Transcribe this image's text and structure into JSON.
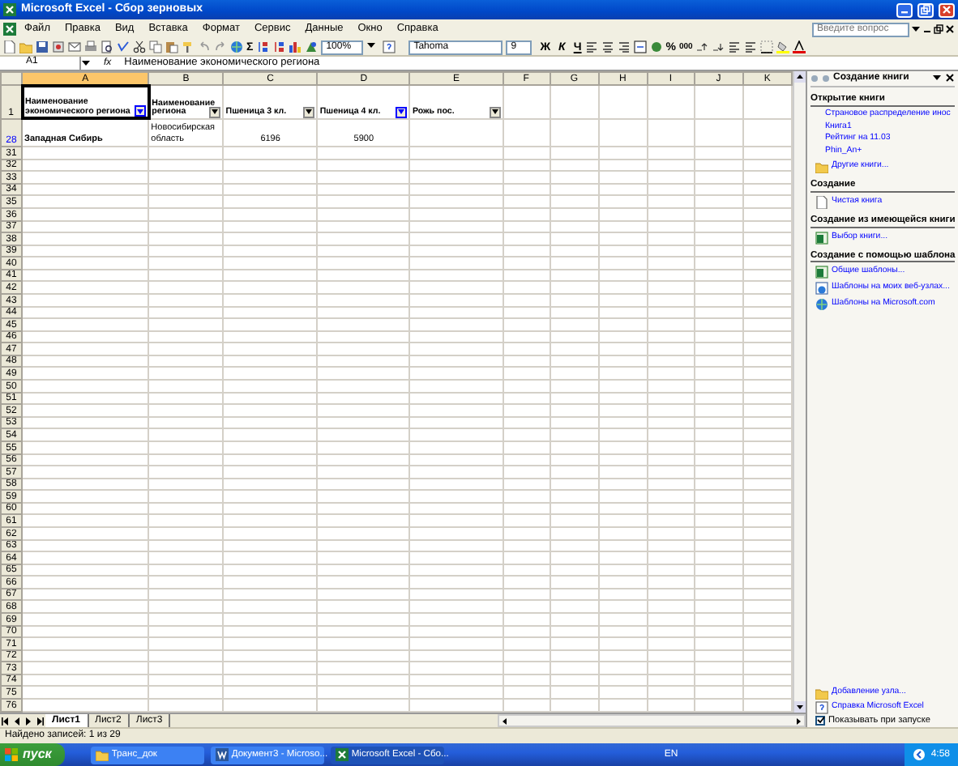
{
  "window": {
    "title": "Microsoft Excel - Сбор зерновых"
  },
  "menu": [
    {
      "label": "Файл",
      "selected": false
    },
    {
      "label": "Правка",
      "selected": false
    },
    {
      "label": "Вид",
      "selected": false
    },
    {
      "label": "Вставка",
      "selected": false
    },
    {
      "label": "Формат",
      "selected": false
    },
    {
      "label": "Сервис",
      "selected": false
    },
    {
      "label": "Данные",
      "selected": false
    },
    {
      "label": "Окно",
      "selected": false
    },
    {
      "label": "Справка",
      "selected": false
    }
  ],
  "help_box": {
    "placeholder": "Введите вопрос"
  },
  "toolbar": {
    "autosum": "Σ",
    "zoom": "100%",
    "font": "Tahoma",
    "size": "9",
    "format": [
      "Ж",
      "К",
      "Ч"
    ],
    "percent": "%",
    "thousands": "000"
  },
  "formula_bar": {
    "name_box": "A1",
    "fx": "fx",
    "formula": "Наименование экономического региона"
  },
  "columns": [
    {
      "label": "A",
      "selected": true
    },
    {
      "label": "B",
      "selected": false
    },
    {
      "label": "C",
      "selected": false
    },
    {
      "label": "D",
      "selected": false
    },
    {
      "label": "E",
      "selected": false
    },
    {
      "label": "F",
      "selected": false
    },
    {
      "label": "G",
      "selected": false
    },
    {
      "label": "H",
      "selected": false
    },
    {
      "label": "I",
      "selected": false
    },
    {
      "label": "J",
      "selected": false
    },
    {
      "label": "K",
      "selected": false
    }
  ],
  "rows": [
    {
      "number": "1",
      "filtered": false,
      "kind": "header",
      "cells": [
        {
          "text": "Наименование экономического региона",
          "filter_active": true,
          "selected": true
        },
        {
          "text": "Наименование региона",
          "filter_active": false,
          "selected": false
        },
        {
          "text": "Пшеница 3 кл.",
          "filter_active": false,
          "selected": false
        },
        {
          "text": "Пшеница 4 кл.",
          "filter_active": true,
          "selected": false
        },
        {
          "text": "Рожь пос.",
          "filter_active": false,
          "selected": false
        }
      ]
    },
    {
      "number": "28",
      "filtered": true,
      "kind": "data",
      "cells": [
        {
          "text": "Западная Сибирь",
          "bold": true
        },
        {
          "text": "Новосибирская область",
          "bold": false
        },
        {
          "text": "6196",
          "bold": false
        },
        {
          "text": "5900",
          "bold": false
        }
      ]
    }
  ],
  "empty_rows": [
    "31",
    "32",
    "33",
    "34",
    "35",
    "36",
    "37",
    "38",
    "39",
    "40",
    "41",
    "42",
    "43",
    "44",
    "45",
    "46",
    "47",
    "48",
    "49",
    "50",
    "51",
    "52",
    "53",
    "54",
    "55",
    "56",
    "57",
    "58",
    "59",
    "60",
    "61",
    "62",
    "63",
    "64",
    "65",
    "66",
    "67",
    "68",
    "69",
    "70",
    "71",
    "72",
    "73",
    "74",
    "75",
    "76"
  ],
  "sheet_tabs": [
    {
      "label": "Лист1",
      "selected": true
    },
    {
      "label": "Лист2",
      "selected": false
    },
    {
      "label": "Лист3",
      "selected": false
    }
  ],
  "status_bar": "Найдено записей: 1 из 29",
  "task_pane": {
    "title": "Создание книги",
    "sections": [
      {
        "heading": "Открытие книги",
        "links": [
          {
            "label": "Страновое распределение инос",
            "kind": "plain"
          },
          {
            "label": "Книга1",
            "kind": "plain"
          },
          {
            "label": "Рейтинг на 11.03",
            "kind": "plain"
          },
          {
            "label": "Phin_An+",
            "kind": "plain"
          },
          {
            "label": "Другие книги...",
            "kind": "folder"
          }
        ]
      },
      {
        "heading": "Создание",
        "links": [
          {
            "label": "Чистая книга",
            "kind": "document"
          }
        ]
      },
      {
        "heading": "Создание из имеющейся книги",
        "links": [
          {
            "label": "Выбор книги...",
            "kind": "workbook"
          }
        ]
      },
      {
        "heading": "Создание с помощью шаблона",
        "links": [
          {
            "label": "Общие шаблоны...",
            "kind": "workbook"
          },
          {
            "label": "Шаблоны на моих веб-узлах...",
            "kind": "web"
          },
          {
            "label": "Шаблоны на Microsoft.com",
            "kind": "globe"
          }
        ]
      }
    ],
    "footer_links": [
      {
        "label": "Добавление узла...",
        "kind": "folder"
      },
      {
        "label": "Справка Microsoft Excel",
        "kind": "help"
      }
    ],
    "show_on_startup": {
      "label": "Показывать при запуске",
      "checked": true
    }
  },
  "taskbar": {
    "start": "пуск",
    "tasks": [
      {
        "label": "Транс_док",
        "kind": "folder",
        "selected": false
      },
      {
        "label": "Документ3 - Microso...",
        "kind": "word",
        "selected": false
      },
      {
        "label": "Microsoft Excel - Сбо...",
        "kind": "excel",
        "selected": true
      }
    ],
    "language": "EN",
    "clock": "4:58"
  }
}
